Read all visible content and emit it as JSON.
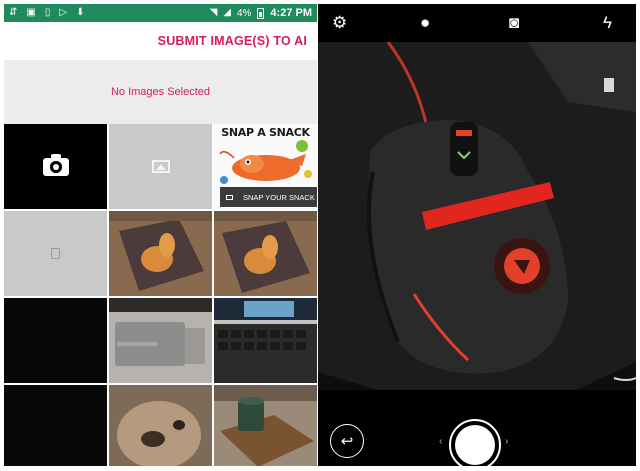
{
  "left_app": {
    "status_bar": {
      "left_icons": [
        "usb-icon",
        "image-icon",
        "phone-icon",
        "play-store-icon",
        "download-icon"
      ],
      "right_icons": [
        "wifi-icon",
        "signal-icon",
        "battery-icon"
      ],
      "battery_percent": "4%",
      "time": "4:27 PM"
    },
    "submit_label": "SUBMIT IMAGE(S) TO AI",
    "empty_state": "No Images Selected",
    "grid": {
      "camera_tile_icon": "camera-icon",
      "gallery_tile_icon": "gallery-icon",
      "file_tile_icon": "file-icon",
      "snack_tile": {
        "title": "SNAP A SNACK",
        "caption": "SNAP YOUR SNACK"
      }
    }
  },
  "right_app": {
    "top_icons": [
      "settings-icon",
      "filters-icon",
      "switch-camera-icon",
      "flash-auto-icon"
    ],
    "bottom": {
      "back_icon": "back-icon",
      "shutter_icon": "shutter-button",
      "chevron_left": "‹",
      "chevron_right": "›"
    }
  },
  "colors": {
    "accent": "#d81b60",
    "status_bar": "#1f8a5b",
    "placeholder_tile": "#c9c9c9",
    "empty_state_bg": "#ececec"
  }
}
